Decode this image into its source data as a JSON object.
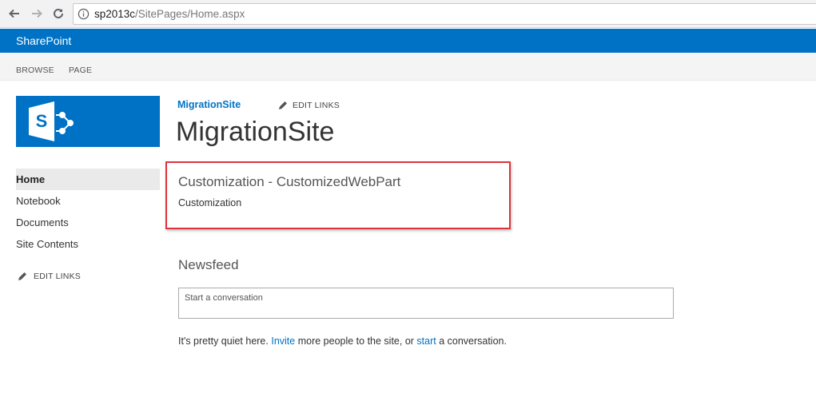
{
  "browser": {
    "url_host": "sp2013c",
    "url_path": "/SitePages/Home.aspx"
  },
  "suite_bar": {
    "title": "SharePoint",
    "background": "#0072c6"
  },
  "ribbon": {
    "tabs": [
      "BROWSE",
      "PAGE"
    ]
  },
  "header": {
    "breadcrumb": "MigrationSite",
    "edit_links": "EDIT LINKS",
    "site_title": "MigrationSite"
  },
  "left_nav": {
    "items": [
      {
        "label": "Home",
        "active": true
      },
      {
        "label": "Notebook"
      },
      {
        "label": "Documents"
      },
      {
        "label": "Site Contents"
      }
    ],
    "edit_links": "EDIT LINKS"
  },
  "web_part": {
    "title": "Customization - CustomizedWebPart",
    "body": "Customization",
    "highlight_color": "#e0333b"
  },
  "newsfeed": {
    "title": "Newsfeed",
    "placeholder": "Start a conversation",
    "quiet_pre": "It's pretty quiet here. ",
    "invite_link": "Invite",
    "quiet_mid": " more people to the site, or ",
    "start_link": "start",
    "quiet_post": " a conversation."
  },
  "icons": [
    "back-arrow-icon",
    "forward-arrow-icon",
    "reload-icon",
    "info-icon",
    "sharepoint-logo-icon",
    "pencil-icon"
  ]
}
